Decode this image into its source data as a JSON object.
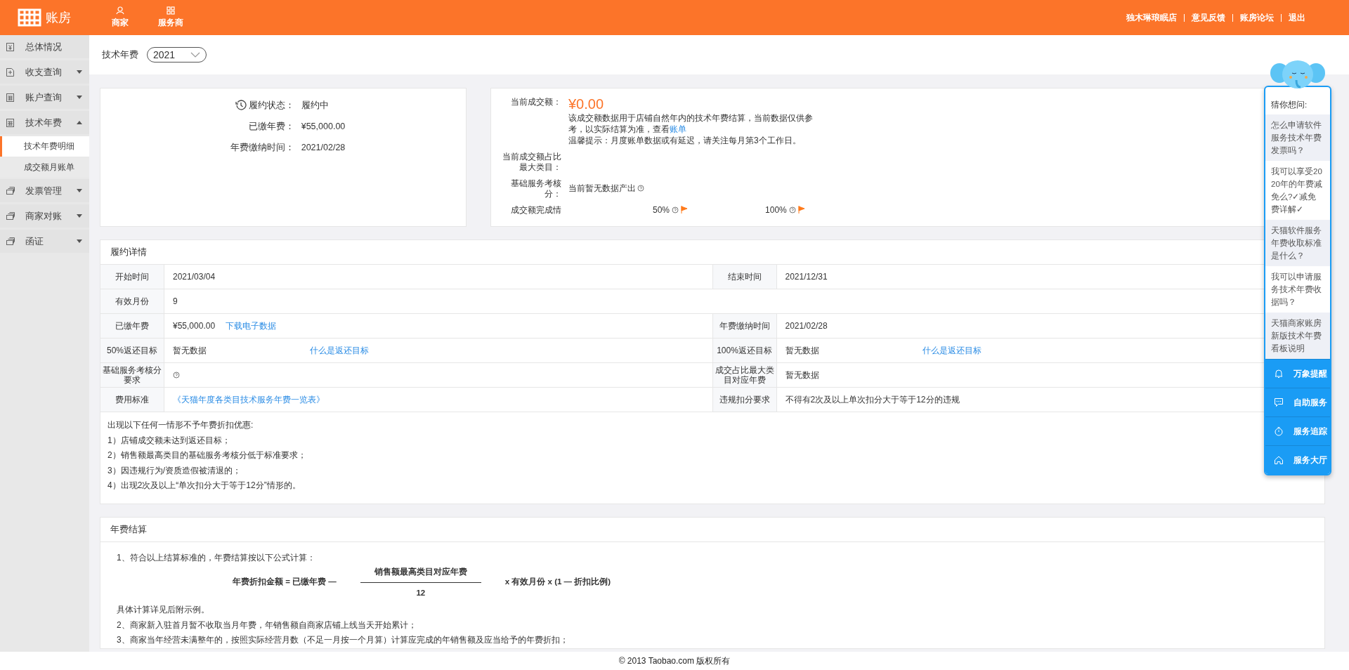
{
  "header": {
    "logo": "账房",
    "nav": [
      {
        "label": "商家",
        "selected": false
      },
      {
        "label": "服务商",
        "selected": false
      }
    ],
    "links": [
      "独木琳琅眠店",
      "意见反馈",
      "账房论坛",
      "退出"
    ]
  },
  "sidebar": {
    "items": [
      {
        "label": "总体情况",
        "selected": false
      },
      {
        "label": "收支查询",
        "selected": false,
        "expanded": false
      },
      {
        "label": "账户查询",
        "selected": false,
        "expanded": false
      },
      {
        "label": "技术年费",
        "selected": false,
        "expanded": true,
        "children": [
          {
            "label": "技术年费明细",
            "selected": true
          },
          {
            "label": "成交额月账单",
            "selected": false
          }
        ]
      },
      {
        "label": "发票管理",
        "selected": false,
        "expanded": false
      },
      {
        "label": "商家对账",
        "selected": false,
        "expanded": false
      },
      {
        "label": "函证",
        "selected": false,
        "expanded": false
      }
    ]
  },
  "filter": {
    "label": "技术年费",
    "year": "2021"
  },
  "status_card": {
    "rows": [
      {
        "label": "履约状态：",
        "value": "履约中"
      },
      {
        "label": "已缴年费：",
        "value": "¥55,000.00"
      },
      {
        "label": "年费缴纳时间：",
        "value": "2021/02/28"
      }
    ]
  },
  "sales_card": {
    "amount_label": "当前成交额：",
    "amount": "¥0.00",
    "note": "该成交额数据用于店铺自然年内的技术年费结算，当前数据仅供参考，以实际结算为准，查看",
    "note_link": "账单",
    "tip": "温馨提示：月度账单数据或有延迟，请关注每月第3个工作日。",
    "rows": [
      {
        "label": "当前成交额占比最大类目："
      },
      {
        "label": "基础服务考核分：",
        "value": "当前暂无数据产出"
      }
    ],
    "progress_label": "成交额完成情",
    "marks": [
      "50%",
      "100%"
    ]
  },
  "details": {
    "title": "履约详情",
    "rows": [
      [
        {
          "label": "开始时间",
          "value": "2021/03/04"
        },
        {
          "label": "结束时间",
          "value": "2021/12/31"
        }
      ],
      [
        {
          "label": "有效月份",
          "value": "9"
        }
      ],
      [
        {
          "label": "已缴年费",
          "value": "¥55,000.00",
          "link": "下载电子数据"
        },
        {
          "label": "年费缴纳时间",
          "value": "2021/02/28"
        }
      ],
      [
        {
          "label": "50%返还目标",
          "value": "暂无数据",
          "link": "什么是返还目标"
        },
        {
          "label": "100%返还目标",
          "value": "暂无数据",
          "link": "什么是返还目标"
        }
      ],
      [
        {
          "label": "基础服务考核分要求",
          "help": true
        },
        {
          "label": "成交占比最大类目对应年费",
          "value": "暂无数据"
        }
      ],
      [
        {
          "label": "费用标准",
          "link": "《天猫年度各类目技术服务年费一览表》"
        },
        {
          "label": "违规扣分要求",
          "value": "不得有2次及以上单次扣分大于等于12分的违规"
        }
      ]
    ],
    "notes": [
      "出现以下任何一情形不予年费折扣优惠:",
      "1）店铺成交额未达到返还目标；",
      "2）销售额最高类目的基础服务考核分低于标准要求；",
      "3）因违规行为/资质造假被清退的；",
      "4）出现2次及以上“单次扣分大于等于12分”情形的。"
    ]
  },
  "settlement": {
    "title": "年费结算",
    "intro": "1、符合以上结算标准的，年费结算按以下公式计算：",
    "formula": {
      "left": "年费折扣金额 = 已缴年费 —",
      "numerator": "销售额最高类目对应年费",
      "denominator": "12",
      "right": "x 有效月份 x (1 — 折扣比例)"
    },
    "lines": [
      "具体计算详见后附示例。",
      "2、商家新入驻首月暂不收取当月年费，年销售额自商家店铺上线当天开始累计；",
      "3、商家当年经营未满整年的，按照实际经营月数（不足一月按一个月算）计算应完成的年销售额及应当给予的年费折扣；"
    ]
  },
  "assistant": {
    "title": "猜你想问:",
    "questions": [
      "怎么申请软件服务技术年费发票吗？",
      "我可以享受2020年的年费减免么?✓减免费详解✓",
      "天猫软件服务年费收取标准是什么？",
      "我可以申请服务技术年费收据吗？",
      "天猫商家账房新版技术年费看板说明"
    ],
    "actions": [
      "万象提醒",
      "自助服务",
      "服务追踪",
      "服务大厅"
    ]
  },
  "footer": "© 2013 Taobao.com 版权所有"
}
